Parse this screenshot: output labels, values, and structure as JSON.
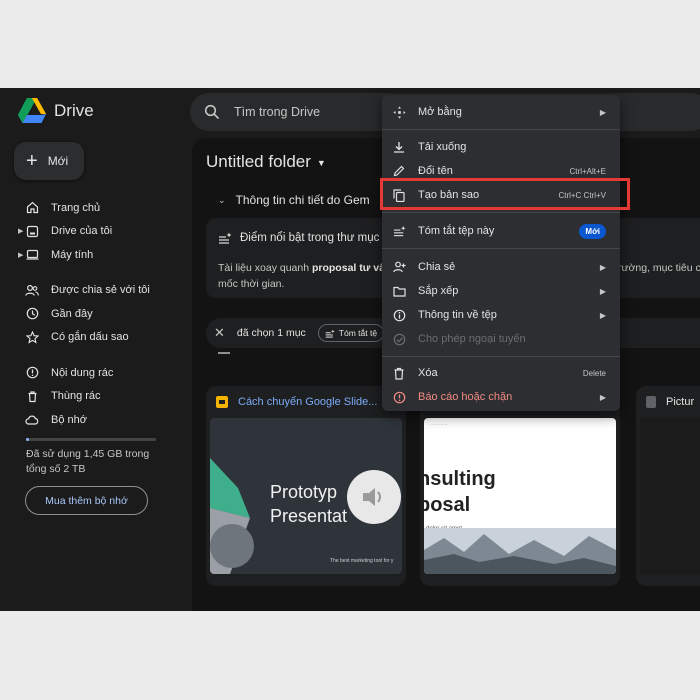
{
  "app": {
    "logo_label": "Drive",
    "search_placeholder": "Tìm trong Drive",
    "new_label": "Mới"
  },
  "sidebar": {
    "items": [
      {
        "label": "Trang chủ",
        "icon": "home-icon"
      },
      {
        "label": "Drive của tôi",
        "icon": "my-drive-icon"
      },
      {
        "label": "Máy tính",
        "icon": "computer-icon"
      },
      {
        "label": "Được chia sẻ với tôi",
        "icon": "shared-icon"
      },
      {
        "label": "Gần đây",
        "icon": "clock-icon"
      },
      {
        "label": "Có gắn dấu sao",
        "icon": "star-icon"
      },
      {
        "label": "Nội dung rác",
        "icon": "spam-icon"
      },
      {
        "label": "Thùng rác",
        "icon": "trash-icon"
      },
      {
        "label": "Bộ nhớ",
        "icon": "cloud-icon"
      }
    ],
    "storage_text": "Đã sử dụng 1,45 GB trong tổng số 2 TB",
    "storage_used_fraction": 0.02,
    "buy_storage_label": "Mua thêm bộ nhớ"
  },
  "main": {
    "folder_title": "Untitled folder",
    "gemini_heading": "Thông tin chi tiết do Gem",
    "gemini_card_title": "Điểm nổi bật trong thư mục",
    "gemini_body_start": "Tài liệu xoay quanh",
    "gemini_body_bold": "proposal tư vấ",
    "gemini_body_tail": "rường, mục tiêu c",
    "gemini_body_line2": "mốc thời gian.",
    "selection_text": "đã chọn 1 mục",
    "summarize_chip": "Tóm tắt tệ",
    "files": [
      {
        "name": "Cách chuyển Google Slide...",
        "thumb_title": "Prototyp\nPresentat",
        "thumb_small": "The best marketing tool for y"
      },
      {
        "name": "",
        "thumb_title": "nsulting\nposal",
        "thumb_small": "dolor sit amet."
      },
      {
        "name": "Pictur"
      }
    ]
  },
  "context_menu": {
    "items": [
      {
        "label": "Mở bằng",
        "icon": "open-with-icon",
        "submenu": true
      },
      {
        "label": "Tải xuống",
        "icon": "download-icon"
      },
      {
        "label": "Đổi tên",
        "icon": "rename-icon",
        "shortcut": "Ctrl+Alt+E"
      },
      {
        "label": "Tạo bản sao",
        "icon": "copy-icon",
        "shortcut": "Ctrl+C Ctrl+V"
      },
      {
        "label": "Tóm tắt tệp này",
        "icon": "summarize-icon",
        "badge": "Mới"
      },
      {
        "label": "Chia sẻ",
        "icon": "share-icon",
        "submenu": true
      },
      {
        "label": "Sắp xếp",
        "icon": "organize-icon",
        "submenu": true
      },
      {
        "label": "Thông tin về tệp",
        "icon": "info-icon",
        "submenu": true
      },
      {
        "label": "Cho phép ngoại tuyến",
        "icon": "offline-icon",
        "disabled": true
      },
      {
        "label": "Xóa",
        "icon": "delete-icon",
        "shortcut": "Delete"
      },
      {
        "label": "Báo cáo hoặc chặn",
        "icon": "report-icon",
        "submenu": true,
        "danger": true
      }
    ]
  },
  "colors": {
    "accent": "#a8c7fa",
    "highlight": "#e53935",
    "badge": "#0b57d0",
    "danger": "#f28b82"
  }
}
